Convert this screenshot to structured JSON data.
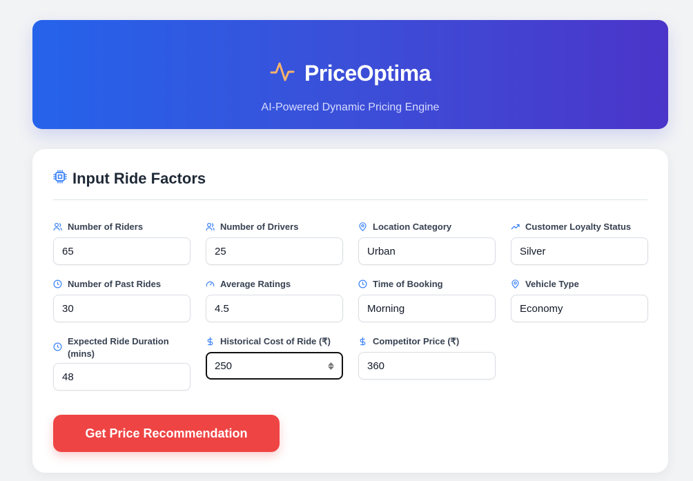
{
  "header": {
    "title": "PriceOptima",
    "subtitle": "AI-Powered Dynamic Pricing Engine",
    "logo_icon": "pulse-icon"
  },
  "form": {
    "title": "Input Ride Factors",
    "title_icon": "cpu-icon",
    "fields": [
      {
        "label": "Number of Riders",
        "value": "65",
        "icon": "users-icon"
      },
      {
        "label": "Number of Drivers",
        "value": "25",
        "icon": "users-icon"
      },
      {
        "label": "Location Category",
        "value": "Urban",
        "icon": "map-pin-icon"
      },
      {
        "label": "Customer Loyalty Status",
        "value": "Silver",
        "icon": "trending-up-icon"
      },
      {
        "label": "Number of Past Rides",
        "value": "30",
        "icon": "clock-icon"
      },
      {
        "label": "Average Ratings",
        "value": "4.5",
        "icon": "gauge-icon"
      },
      {
        "label": "Time of Booking",
        "value": "Morning",
        "icon": "clock-icon"
      },
      {
        "label": "Vehicle Type",
        "value": "Economy",
        "icon": "map-pin-icon"
      },
      {
        "label": "Expected Ride Duration (mins)",
        "value": "48",
        "icon": "clock-icon"
      },
      {
        "label": "Historical Cost of Ride (₹)",
        "value": "250",
        "icon": "dollar-icon"
      },
      {
        "label": "Competitor Price (₹)",
        "value": "360",
        "icon": "dollar-icon"
      }
    ],
    "submit_label": "Get Price Recommendation"
  },
  "colors": {
    "accent": "#2563eb",
    "header_gradient_end": "#4b35c9",
    "cta": "#ef4444",
    "logo": "#f6b26b"
  }
}
